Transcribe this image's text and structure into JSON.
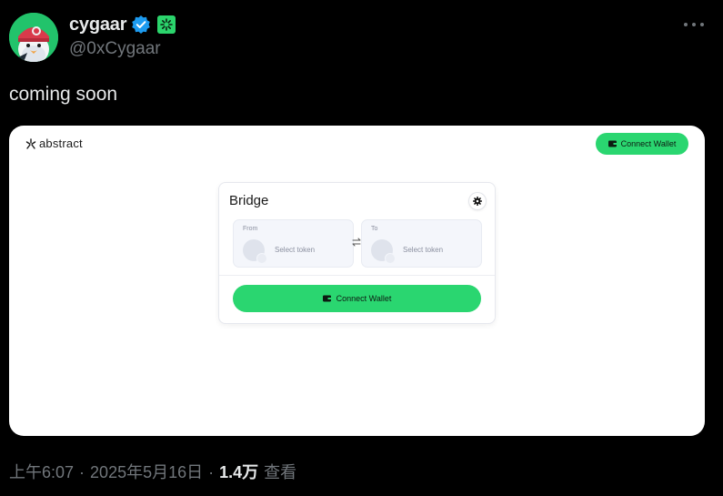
{
  "author": {
    "display_name": "cygaar",
    "handle": "@0xCygaar",
    "avatar_icon": "penguin-avatar-icon",
    "verified_icon": "verified-badge-icon",
    "affiliation_icon": "affiliate-badge-icon"
  },
  "menu_icon": "more-options-icon",
  "tweet": {
    "text": "coming soon"
  },
  "media": {
    "logo_text": "abstract",
    "top_connect_label": "Connect Wallet",
    "bridge": {
      "title": "Bridge",
      "from_label": "From",
      "to_label": "To",
      "from_placeholder": "Select token",
      "to_placeholder": "Select token",
      "connect_label": "Connect Wallet"
    }
  },
  "footer": {
    "time": "上午6:07",
    "date": "2025年5月16日",
    "views_count": "1.4万",
    "views_label": "查看",
    "separator": "·"
  },
  "colors": {
    "background": "#000000",
    "accent_green": "#2ad670",
    "verified_blue": "#1d9bf0",
    "muted_text": "#71767b"
  }
}
